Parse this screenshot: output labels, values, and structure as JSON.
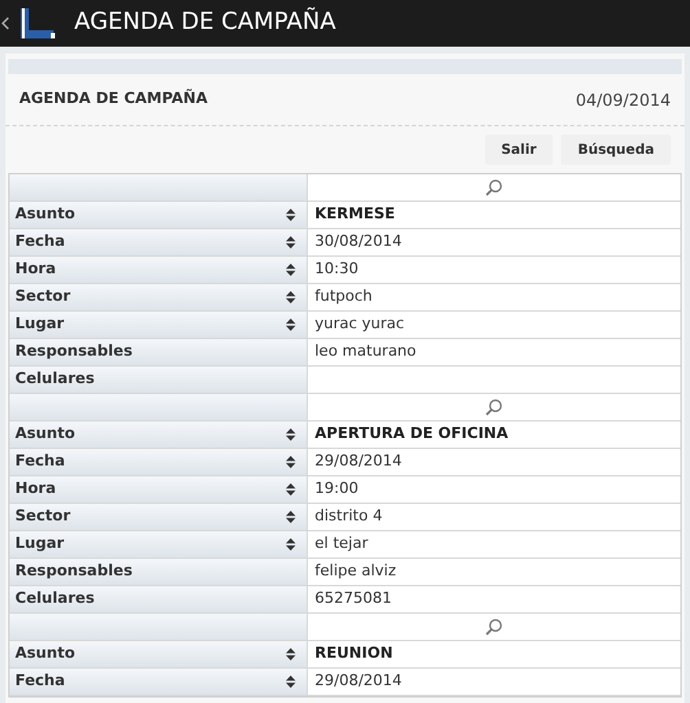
{
  "app_bar": {
    "title": "AGENDA DE CAMPAÑA"
  },
  "header": {
    "title": "AGENDA DE CAMPAÑA",
    "date": "04/09/2014"
  },
  "buttons": [
    "Salir",
    "Búsqueda"
  ],
  "records": [
    {
      "fields": [
        {
          "label": "Asunto",
          "sortable": true,
          "kind": "subject",
          "value": "KERMESE"
        },
        {
          "label": "Fecha",
          "sortable": true,
          "kind": "plain",
          "value": "30/08/2014"
        },
        {
          "label": "Hora",
          "sortable": true,
          "kind": "plain",
          "value": "10:30"
        },
        {
          "label": "Sector",
          "sortable": true,
          "kind": "plain",
          "value": "futpoch"
        },
        {
          "label": "Lugar",
          "sortable": true,
          "kind": "plain",
          "value": "yurac yurac"
        },
        {
          "label": "Responsables",
          "sortable": false,
          "kind": "plain",
          "value": "leo maturano"
        },
        {
          "label": "Celulares",
          "sortable": false,
          "kind": "plain"
        }
      ]
    },
    {
      "fields": [
        {
          "label": "Asunto",
          "sortable": true,
          "kind": "subject",
          "value": "APERTURA DE OFICINA"
        },
        {
          "label": "Fecha",
          "sortable": true,
          "kind": "plain",
          "value": "29/08/2014"
        },
        {
          "label": "Hora",
          "sortable": true,
          "kind": "plain",
          "value": "19:00"
        },
        {
          "label": "Sector",
          "sortable": true,
          "kind": "plain",
          "value": "distrito 4"
        },
        {
          "label": "Lugar",
          "sortable": true,
          "kind": "plain",
          "value": "el tejar"
        },
        {
          "label": "Responsables",
          "sortable": false,
          "kind": "plain",
          "value": "felipe alviz"
        },
        {
          "label": "Celulares",
          "sortable": false,
          "kind": "plain",
          "value": "65275081"
        }
      ]
    },
    {
      "fields": [
        {
          "label": "Asunto",
          "sortable": true,
          "kind": "subject",
          "value": "REUNION"
        },
        {
          "label": "Fecha",
          "sortable": true,
          "kind": "plain",
          "value": "29/08/2014"
        }
      ]
    }
  ]
}
